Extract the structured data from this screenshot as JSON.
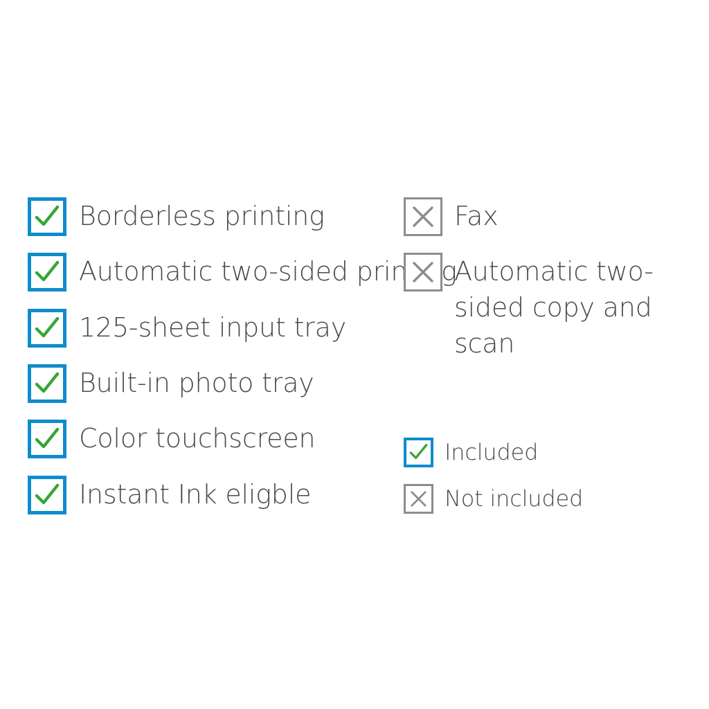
{
  "colors": {
    "included_box_border": "#0f8ccc",
    "included_check": "#35a535",
    "excluded_box_border": "#8c8c8c",
    "excluded_cross": "#8c8c8c",
    "text": "#4a4a4a",
    "background": "#ffffff"
  },
  "left_column": {
    "items": [
      {
        "label": "Borderless printing",
        "status": "included",
        "icon": "checkmark-icon"
      },
      {
        "label": "Automatic two-sided printing",
        "status": "included",
        "icon": "checkmark-icon"
      },
      {
        "label": "125-sheet input tray",
        "status": "included",
        "icon": "checkmark-icon"
      },
      {
        "label": "Built-in photo tray",
        "status": "included",
        "icon": "checkmark-icon"
      },
      {
        "label": "Color touchscreen",
        "status": "included",
        "icon": "checkmark-icon"
      },
      {
        "label": "Instant Ink eligble",
        "status": "included",
        "icon": "checkmark-icon"
      }
    ]
  },
  "right_column": {
    "items": [
      {
        "label": "Fax",
        "status": "not_included",
        "icon": "cross-icon"
      },
      {
        "label": "Automatic two-sided copy and scan",
        "status": "not_included",
        "icon": "cross-icon"
      }
    ]
  },
  "legend": {
    "items": [
      {
        "label": "Included",
        "status": "included",
        "icon": "checkmark-icon"
      },
      {
        "label": "Not included",
        "status": "not_included",
        "icon": "cross-icon"
      }
    ]
  }
}
